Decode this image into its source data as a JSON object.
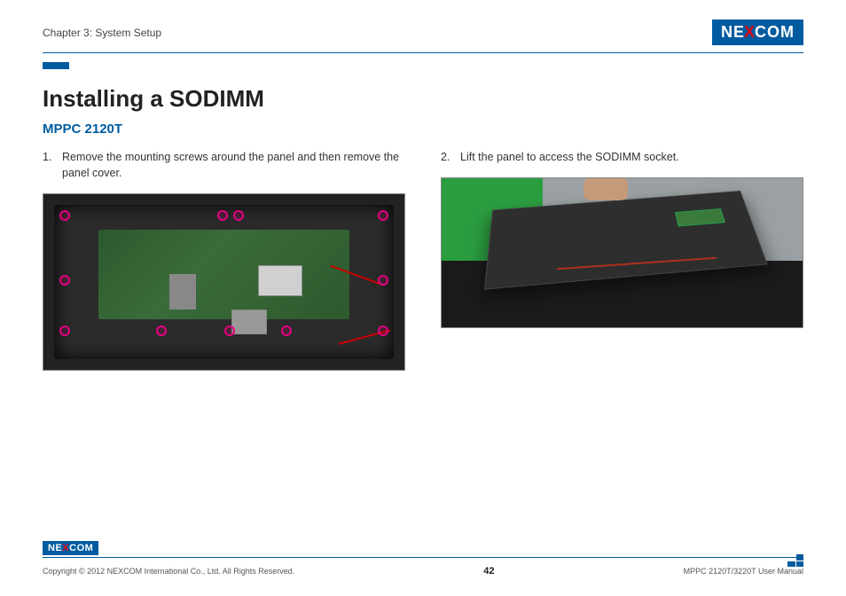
{
  "header": {
    "chapter": "Chapter 3: System Setup",
    "logo": {
      "left": "NE",
      "mid": "X",
      "right": "COM"
    }
  },
  "main": {
    "title": "Installing a SODIMM",
    "subtitle": "MPPC 2120T",
    "steps": [
      {
        "num": "1.",
        "text": "Remove the mounting screws around the panel and then remove the panel cover."
      },
      {
        "num": "2.",
        "text": "Lift the panel to access the SODIMM socket."
      }
    ]
  },
  "footer": {
    "logo": {
      "left": "NE",
      "mid": "X",
      "right": "COM"
    },
    "copyright": "Copyright © 2012 NEXCOM International Co., Ltd. All Rights Reserved.",
    "page": "42",
    "manual": "MPPC 2120T/3220T User Manual"
  }
}
